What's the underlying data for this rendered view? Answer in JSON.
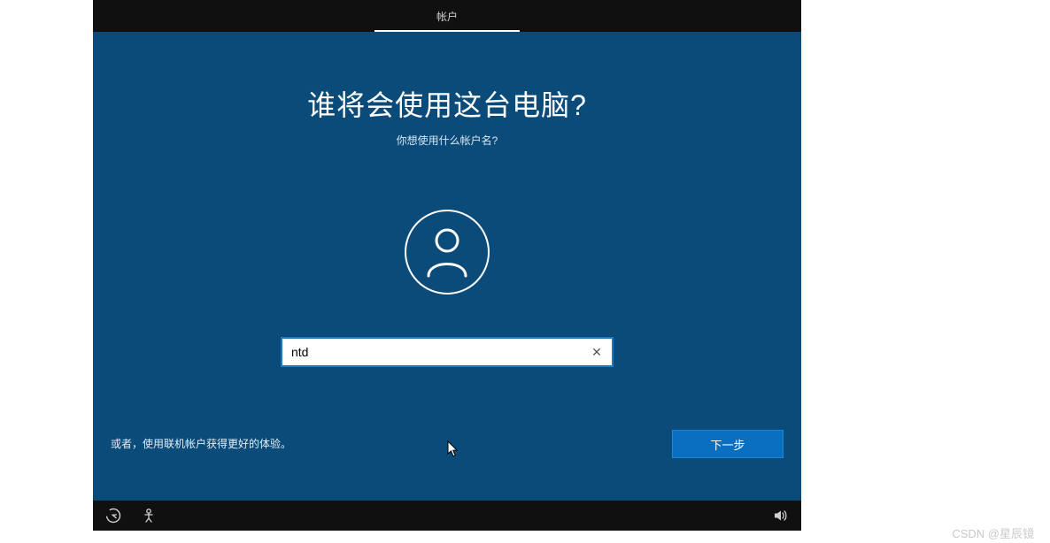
{
  "topbar": {
    "active_tab": "帐户"
  },
  "main": {
    "heading": "谁将会使用这台电脑?",
    "subheading": "你想使用什么帐户名?",
    "username_value": "ntd",
    "alt_account_link": "或者，使用联机帐户获得更好的体验。",
    "next_label": "下一步"
  },
  "icons": {
    "clear": "✕",
    "ease_of_access": "ease-of-access",
    "ime": "ime",
    "volume": "volume"
  },
  "watermark": "CSDN @星辰镜"
}
